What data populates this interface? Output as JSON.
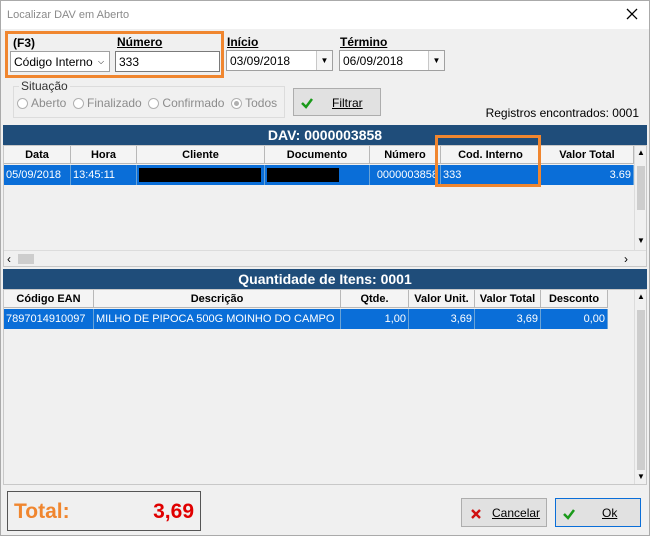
{
  "window": {
    "title": "Localizar DAV em Aberto",
    "close_icon": "close-icon"
  },
  "filter": {
    "f3_label": "(F3)",
    "search_type_value": "Código Interno",
    "numero_label": "Número",
    "numero_value": "333",
    "inicio_label": "Início",
    "inicio_value": "03/09/2018",
    "termino_label": "Término",
    "termino_value": "06/09/2018",
    "situacao_label": "Situação",
    "situacao_options": [
      "Aberto",
      "Finalizado",
      "Confirmado",
      "Todos"
    ],
    "situacao_selected": "Todos",
    "filter_button": "Filtrar",
    "records_label": "Registros encontrados: 0001"
  },
  "dav_grid": {
    "header": "DAV: 0000003858",
    "columns": [
      "Data",
      "Hora",
      "Cliente",
      "Documento",
      "Número",
      "Cod. Interno",
      "Valor Total"
    ],
    "row": {
      "data": "05/09/2018",
      "hora": "13:45:11",
      "cliente": "",
      "documento": "",
      "numero": "0000003858",
      "cod_interno": "333",
      "valor_total": "3.69"
    }
  },
  "items_grid": {
    "header": "Quantidade de Itens: 0001",
    "columns": [
      "Código EAN",
      "Descrição",
      "Qtde.",
      "Valor Unit.",
      "Valor Total",
      "Desconto"
    ],
    "row": {
      "ean": "7897014910097",
      "descricao": "MILHO DE PIPOCA 500G MOINHO DO CAMPO",
      "qtde": "1,00",
      "valor_unit": "3,69",
      "valor_total": "3,69",
      "desconto": "0,00"
    }
  },
  "footer": {
    "total_label": "Total:",
    "total_value": "3,69",
    "cancel_button": "Cancelar",
    "ok_button": "Ok"
  },
  "colors": {
    "accent_orange": "#f0862f",
    "grid_header": "#1f4d7a",
    "selection": "#0a6ed8",
    "total_label": "#f0862f",
    "total_value": "#e00000"
  }
}
